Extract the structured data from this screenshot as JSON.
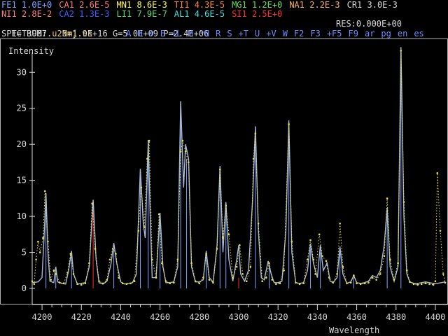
{
  "elements_row1": [
    {
      "name": "FE1",
      "value": "1.0E+0",
      "color": "#7fa4ff"
    },
    {
      "name": "CA1",
      "value": "2.6E-5",
      "color": "#ff7a7a"
    },
    {
      "name": "MN1",
      "value": "8.6E-3",
      "color": "#ffff60"
    },
    {
      "name": "TI1",
      "value": "4.3E-5",
      "color": "#ff8a30"
    },
    {
      "name": "MG1",
      "value": "1.2E+0",
      "color": "#60e060"
    },
    {
      "name": "NA1",
      "value": "2.2E-3",
      "color": "#ffb060"
    },
    {
      "name": "CR1",
      "value": "3.0E-3",
      "color": "#d8d8d8"
    }
  ],
  "elements_row2": [
    {
      "name": "NI1",
      "value": "2.8E-2",
      "color": "#ff8080"
    },
    {
      "name": "CA2",
      "value": "1.3E-3",
      "color": "#4060ff"
    },
    {
      "name": "LI1",
      "value": "7.9E-7",
      "color": "#60e060"
    },
    {
      "name": "AL1",
      "value": "4.6E-5",
      "color": "#40e0e0"
    },
    {
      "name": "SI1",
      "value": "2.5E+0",
      "color": "#ff3030"
    }
  ],
  "status": {
    "temperature": "T= 3967.",
    "density": "N=1.9E+16",
    "g": "G=5.0E+09",
    "p": "P=2.4E+06",
    "res": "RES:0.000E+00"
  },
  "spectrum": {
    "label": "SPECTRUM:",
    "name": "u23mj.cs"
  },
  "commands": [
    "A",
    "B",
    "D",
    "E",
    "+L",
    "M",
    "^N",
    "R",
    "S",
    "+T",
    "U",
    "+V",
    "W",
    "F2",
    "F3",
    "+F5",
    "F9",
    "ar",
    "pg",
    "en",
    "es"
  ],
  "chart_data": {
    "type": "line",
    "ylabel": "Intensity",
    "xlabel": "Wavelength",
    "xlim": [
      4195,
      4405
    ],
    "ylim": [
      0,
      31
    ],
    "xticks": [
      4200,
      4220,
      4240,
      4260,
      4280,
      4300,
      4320,
      4340,
      4360,
      4380,
      4400
    ],
    "yticks": [
      0,
      5,
      10,
      15,
      20,
      25,
      30
    ],
    "series": [
      {
        "color": "#a8b8d8",
        "points": [
          [
            4195,
            0.8
          ],
          [
            4198,
            0.9
          ],
          [
            4200,
            1.5
          ],
          [
            4201,
            7.0
          ],
          [
            4202,
            13.2
          ],
          [
            4203,
            5.0
          ],
          [
            4204,
            1.0
          ],
          [
            4206,
            0.8
          ],
          [
            4207,
            3.0
          ],
          [
            4208,
            0.9
          ],
          [
            4210,
            0.7
          ],
          [
            4212,
            0.6
          ],
          [
            4213.5,
            2.5
          ],
          [
            4215,
            5.2
          ],
          [
            4216,
            2.0
          ],
          [
            4218,
            0.6
          ],
          [
            4220,
            0.7
          ],
          [
            4222,
            0.8
          ],
          [
            4224,
            3.0
          ],
          [
            4226,
            12.3
          ],
          [
            4227.5,
            4.0
          ],
          [
            4229,
            0.8
          ],
          [
            4231,
            0.6
          ],
          [
            4233,
            1.0
          ],
          [
            4235,
            3.3
          ],
          [
            4236.5,
            6.3
          ],
          [
            4238,
            3.5
          ],
          [
            4240,
            0.9
          ],
          [
            4242,
            0.6
          ],
          [
            4244,
            0.7
          ],
          [
            4246,
            0.8
          ],
          [
            4248,
            2.0
          ],
          [
            4250,
            16.6
          ],
          [
            4251.5,
            9.0
          ],
          [
            4252.5,
            7.0
          ],
          [
            4254,
            20.6
          ],
          [
            4255,
            10.0
          ],
          [
            4256,
            1.5
          ],
          [
            4258,
            1.5
          ],
          [
            4260,
            10.5
          ],
          [
            4261.5,
            3.0
          ],
          [
            4263,
            0.8
          ],
          [
            4265,
            0.8
          ],
          [
            4267,
            0.9
          ],
          [
            4269,
            3.0
          ],
          [
            4270.5,
            26.0
          ],
          [
            4272,
            14.0
          ],
          [
            4273,
            20.0
          ],
          [
            4274.5,
            18.0
          ],
          [
            4276,
            3.0
          ],
          [
            4278,
            0.9
          ],
          [
            4280,
            0.9
          ],
          [
            4282,
            1.2
          ],
          [
            4283.5,
            5.2
          ],
          [
            4285,
            1.5
          ],
          [
            4287,
            0.9
          ],
          [
            4289,
            6.0
          ],
          [
            4290.5,
            17.0
          ],
          [
            4292,
            5.0
          ],
          [
            4293.5,
            12.0
          ],
          [
            4295,
            4.0
          ],
          [
            4297,
            1.0
          ],
          [
            4299,
            4.0
          ],
          [
            4300,
            6.0
          ],
          [
            4301,
            2.0
          ],
          [
            4303,
            1.0
          ],
          [
            4305,
            2.5
          ],
          [
            4307,
            12.0
          ],
          [
            4308.5,
            22.5
          ],
          [
            4310,
            8.0
          ],
          [
            4311.5,
            1.5
          ],
          [
            4313,
            1.2
          ],
          [
            4315,
            3.8
          ],
          [
            4316.5,
            2.0
          ],
          [
            4318,
            0.8
          ],
          [
            4320,
            0.8
          ],
          [
            4322,
            1.0
          ],
          [
            4324,
            8.0
          ],
          [
            4325.5,
            23.3
          ],
          [
            4327,
            5.0
          ],
          [
            4329,
            0.8
          ],
          [
            4331,
            0.7
          ],
          [
            4333,
            0.8
          ],
          [
            4335,
            2.5
          ],
          [
            4336.5,
            6.2
          ],
          [
            4338,
            3.5
          ],
          [
            4340,
            1.5
          ],
          [
            4341.5,
            6.0
          ],
          [
            4343,
            2.5
          ],
          [
            4345,
            3.5
          ],
          [
            4346.5,
            1.0
          ],
          [
            4348,
            0.8
          ],
          [
            4350,
            1.5
          ],
          [
            4351.5,
            5.8
          ],
          [
            4353,
            2.0
          ],
          [
            4355,
            0.7
          ],
          [
            4357,
            0.9
          ],
          [
            4358.5,
            1.8
          ],
          [
            4360,
            0.8
          ],
          [
            4362,
            0.7
          ],
          [
            4364,
            0.8
          ],
          [
            4366,
            1.0
          ],
          [
            4368,
            1.8
          ],
          [
            4370,
            1.5
          ],
          [
            4372,
            2.5
          ],
          [
            4374,
            6.0
          ],
          [
            4375.5,
            11.2
          ],
          [
            4377,
            3.0
          ],
          [
            4379,
            1.0
          ],
          [
            4381,
            3.0
          ],
          [
            4382.5,
            33.5
          ],
          [
            4384,
            10.0
          ],
          [
            4385.5,
            2.0
          ],
          [
            4387,
            0.9
          ],
          [
            4389,
            0.7
          ],
          [
            4391,
            0.7
          ],
          [
            4393,
            0.8
          ],
          [
            4395,
            0.9
          ],
          [
            4397,
            0.8
          ],
          [
            4399,
            0.7
          ],
          [
            4401,
            0.7
          ],
          [
            4403,
            0.8
          ],
          [
            4405,
            0.9
          ]
        ]
      },
      {
        "color": "#e8e040",
        "points": [
          [
            4195,
            1.0
          ],
          [
            4196,
            0.6
          ],
          [
            4197,
            4.0
          ],
          [
            4198,
            6.5
          ],
          [
            4199,
            5.0
          ],
          [
            4200.5,
            7.0
          ],
          [
            4201.5,
            13.5
          ],
          [
            4203,
            6.5
          ],
          [
            4204.5,
            1.2
          ],
          [
            4206,
            2.5
          ],
          [
            4207,
            2.0
          ],
          [
            4209,
            0.8
          ],
          [
            4211,
            0.7
          ],
          [
            4213,
            2.2
          ],
          [
            4214.5,
            4.8
          ],
          [
            4216,
            2.0
          ],
          [
            4218,
            0.6
          ],
          [
            4220,
            0.5
          ],
          [
            4222,
            0.7
          ],
          [
            4224,
            3.5
          ],
          [
            4225.5,
            11.8
          ],
          [
            4227,
            5.5
          ],
          [
            4229,
            1.0
          ],
          [
            4231,
            0.7
          ],
          [
            4233,
            1.2
          ],
          [
            4234.5,
            4.0
          ],
          [
            4236,
            5.5
          ],
          [
            4237.5,
            4.8
          ],
          [
            4239,
            1.5
          ],
          [
            4241,
            0.7
          ],
          [
            4243,
            0.6
          ],
          [
            4245,
            0.7
          ],
          [
            4247,
            1.0
          ],
          [
            4249,
            8.0
          ],
          [
            4250.5,
            14.0
          ],
          [
            4252,
            8.5
          ],
          [
            4253.5,
            18.0
          ],
          [
            4254.5,
            20.5
          ],
          [
            4256,
            4.0
          ],
          [
            4258,
            1.5
          ],
          [
            4259.5,
            10.3
          ],
          [
            4261,
            3.5
          ],
          [
            4263,
            1.0
          ],
          [
            4265,
            0.7
          ],
          [
            4267,
            0.8
          ],
          [
            4269,
            4.0
          ],
          [
            4270.5,
            19.0
          ],
          [
            4271.5,
            20.5
          ],
          [
            4273,
            19.0
          ],
          [
            4274.5,
            17.5
          ],
          [
            4276,
            3.5
          ],
          [
            4278,
            1.0
          ],
          [
            4280,
            0.7
          ],
          [
            4282,
            1.5
          ],
          [
            4283.5,
            4.8
          ],
          [
            4285,
            1.2
          ],
          [
            4287,
            0.8
          ],
          [
            4289,
            5.5
          ],
          [
            4290.5,
            16.5
          ],
          [
            4292,
            7.0
          ],
          [
            4293.5,
            11.5
          ],
          [
            4295,
            7.5
          ],
          [
            4297,
            1.5
          ],
          [
            4299,
            3.0
          ],
          [
            4300.5,
            6.0
          ],
          [
            4302,
            2.0
          ],
          [
            4304,
            1.0
          ],
          [
            4306,
            3.0
          ],
          [
            4307.5,
            18.0
          ],
          [
            4308.5,
            21.5
          ],
          [
            4310,
            9.0
          ],
          [
            4312,
            1.0
          ],
          [
            4314,
            1.5
          ],
          [
            4315.5,
            3.5
          ],
          [
            4317,
            1.2
          ],
          [
            4319,
            0.6
          ],
          [
            4321,
            0.7
          ],
          [
            4323,
            2.5
          ],
          [
            4325.5,
            22.8
          ],
          [
            4327,
            6.5
          ],
          [
            4329,
            0.8
          ],
          [
            4331,
            0.6
          ],
          [
            4333,
            0.7
          ],
          [
            4335,
            4.0
          ],
          [
            4336.5,
            6.7
          ],
          [
            4338,
            4.0
          ],
          [
            4339,
            2.0
          ],
          [
            4341,
            7.5
          ],
          [
            4342.5,
            4.5
          ],
          [
            4344.5,
            3.8
          ],
          [
            4346,
            1.5
          ],
          [
            4348,
            0.8
          ],
          [
            4350,
            2.0
          ],
          [
            4351.5,
            9.0
          ],
          [
            4353,
            3.0
          ],
          [
            4355,
            0.7
          ],
          [
            4357,
            0.8
          ],
          [
            4358.5,
            1.8
          ],
          [
            4360,
            0.7
          ],
          [
            4362,
            0.6
          ],
          [
            4364,
            0.7
          ],
          [
            4366,
            0.8
          ],
          [
            4368,
            1.5
          ],
          [
            4370,
            1.2
          ],
          [
            4372,
            2.0
          ],
          [
            4374,
            4.5
          ],
          [
            4375.5,
            12.5
          ],
          [
            4377,
            4.0
          ],
          [
            4379,
            1.2
          ],
          [
            4381,
            3.5
          ],
          [
            4382.5,
            33.0
          ],
          [
            4384,
            12.0
          ],
          [
            4385.5,
            2.5
          ],
          [
            4387,
            0.9
          ],
          [
            4389,
            0.6
          ],
          [
            4391,
            0.5
          ],
          [
            4393,
            0.6
          ],
          [
            4395,
            0.7
          ],
          [
            4397,
            0.6
          ],
          [
            4399,
            0.5
          ],
          [
            4400,
            1.0
          ],
          [
            4401,
            16.0
          ],
          [
            4402.5,
            8.0
          ],
          [
            4404,
            2.0
          ],
          [
            4405,
            0.8
          ]
        ]
      }
    ],
    "line_spikes": [
      {
        "x": 4202,
        "y": 11.0,
        "color": "#7fa4ff"
      },
      {
        "x": 4207,
        "y": 2.2,
        "color": "#7fa4ff"
      },
      {
        "x": 4215,
        "y": 4.5,
        "color": "#7fa4ff"
      },
      {
        "x": 4226,
        "y": 11.0,
        "color": "#ff3030"
      },
      {
        "x": 4236.5,
        "y": 5.5,
        "color": "#7fa4ff"
      },
      {
        "x": 4250,
        "y": 15.0,
        "color": "#7fa4ff"
      },
      {
        "x": 4254,
        "y": 19.0,
        "color": "#7fa4ff"
      },
      {
        "x": 4260,
        "y": 9.5,
        "color": "#7fa4ff"
      },
      {
        "x": 4270.5,
        "y": 24.5,
        "color": "#7fa4ff"
      },
      {
        "x": 4273.5,
        "y": 18.0,
        "color": "#7fa4ff"
      },
      {
        "x": 4283.5,
        "y": 4.5,
        "color": "#7fa4ff"
      },
      {
        "x": 4290.5,
        "y": 16.0,
        "color": "#7fa4ff"
      },
      {
        "x": 4293.5,
        "y": 11.0,
        "color": "#7fa4ff"
      },
      {
        "x": 4300,
        "y": 1.5,
        "color": "#ff3030"
      },
      {
        "x": 4308.5,
        "y": 21.0,
        "color": "#7fa4ff"
      },
      {
        "x": 4315.5,
        "y": 3.2,
        "color": "#7fa4ff"
      },
      {
        "x": 4325.5,
        "y": 22.0,
        "color": "#7fa4ff"
      },
      {
        "x": 4336.5,
        "y": 5.5,
        "color": "#7fa4ff"
      },
      {
        "x": 4341.5,
        "y": 5.0,
        "color": "#7fa4ff"
      },
      {
        "x": 4351.5,
        "y": 5.0,
        "color": "#7fa4ff"
      },
      {
        "x": 4358.5,
        "y": 1.5,
        "color": "#7fa4ff"
      },
      {
        "x": 4375.5,
        "y": 10.0,
        "color": "#7fa4ff"
      },
      {
        "x": 4382.5,
        "y": 32.0,
        "color": "#7fa4ff"
      }
    ],
    "grid": false
  }
}
